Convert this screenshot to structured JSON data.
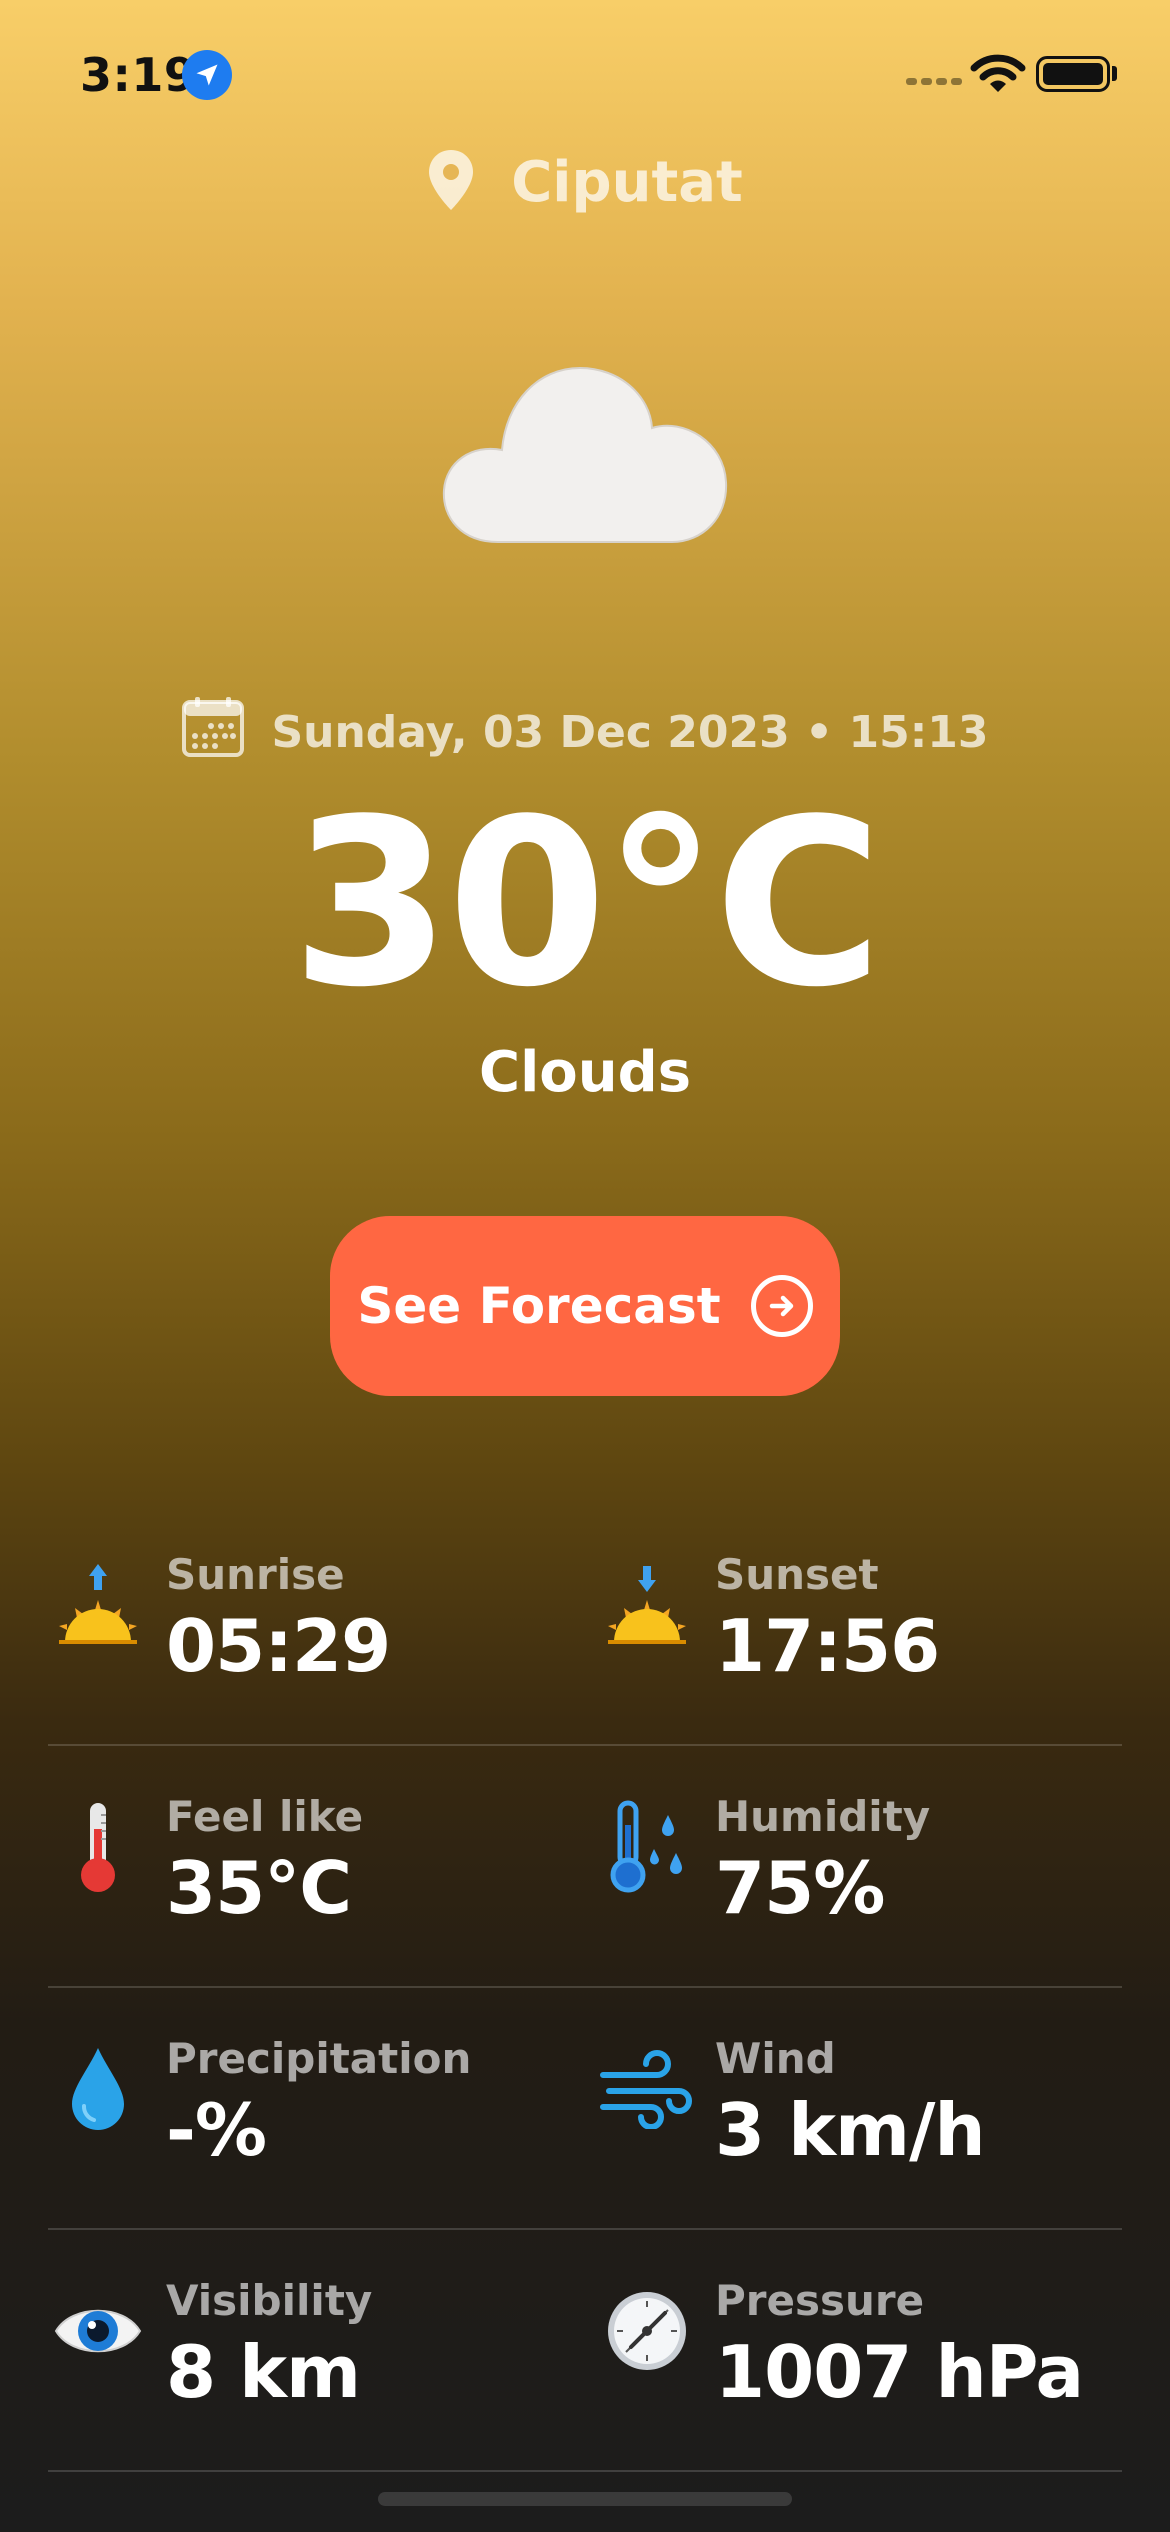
{
  "status_bar": {
    "time": "3:19"
  },
  "location": {
    "name": "Ciputat"
  },
  "datetime": {
    "text": "Sunday, 03 Dec 2023 • 15:13"
  },
  "weather": {
    "temperature": "30°C",
    "condition": "Clouds",
    "icon": "cloud-icon"
  },
  "forecast_button": {
    "label": "See Forecast"
  },
  "stats": {
    "sunrise": {
      "label": "Sunrise",
      "value": "05:29",
      "icon": "sunrise-icon"
    },
    "sunset": {
      "label": "Sunset",
      "value": "17:56",
      "icon": "sunset-icon"
    },
    "feel_like": {
      "label": "Feel like",
      "value": "35°C",
      "icon": "thermometer-icon"
    },
    "humidity": {
      "label": "Humidity",
      "value": "75%",
      "icon": "humidity-icon"
    },
    "precipitation": {
      "label": "Precipitation",
      "value": "-%",
      "icon": "droplet-icon"
    },
    "wind": {
      "label": "Wind",
      "value": "3 km/h",
      "icon": "wind-icon"
    },
    "visibility": {
      "label": "Visibility",
      "value": "8 km",
      "icon": "eye-icon"
    },
    "pressure": {
      "label": "Pressure",
      "value": "1007 hPa",
      "icon": "gauge-icon"
    }
  },
  "colors": {
    "accent": "#FF6742",
    "top": "#F8CE68",
    "bottom": "#1C1C1C"
  }
}
